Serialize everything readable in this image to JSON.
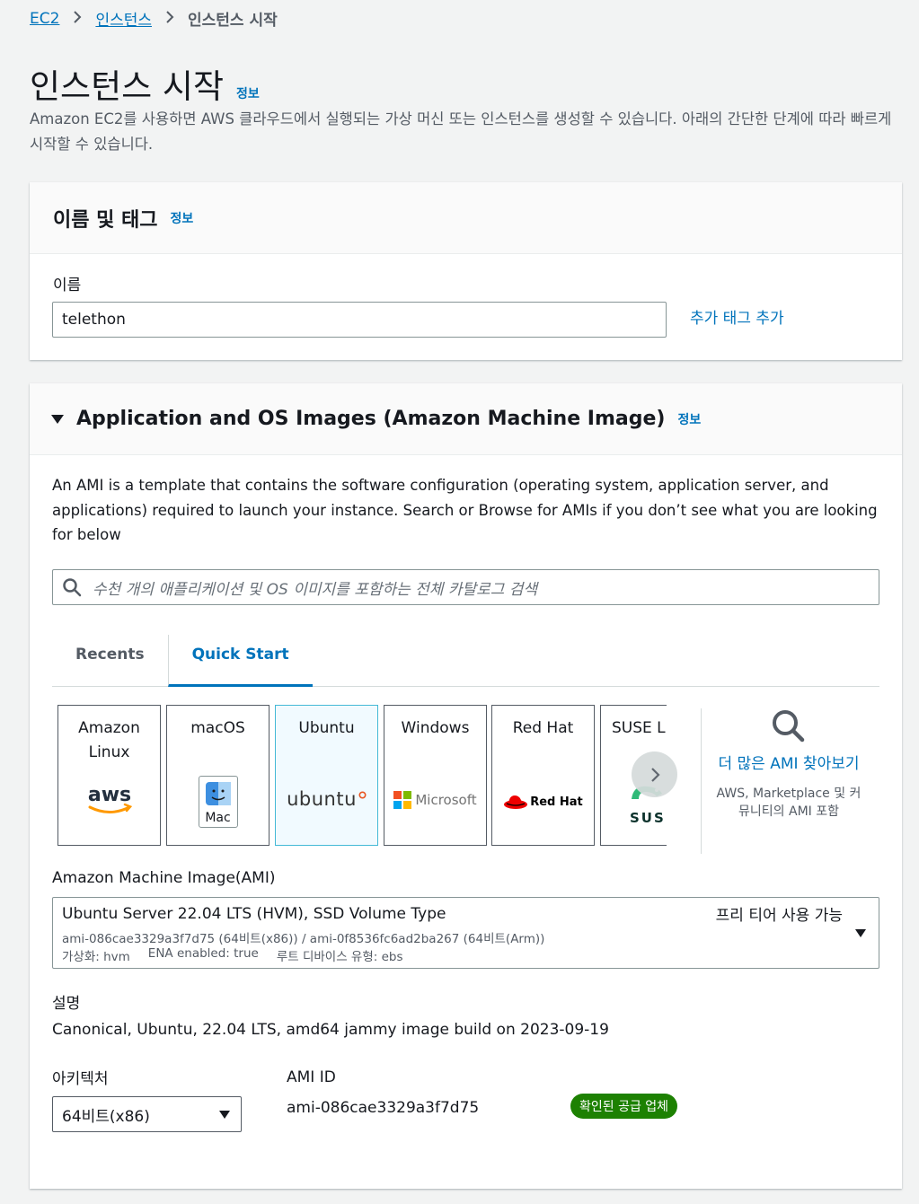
{
  "breadcrumb": {
    "items": [
      "EC2",
      "인스턴스"
    ],
    "current": "인스턴스 시작"
  },
  "page": {
    "title": "인스턴스 시작",
    "info": "정보",
    "description": "Amazon EC2를 사용하면 AWS 클라우드에서 실행되는 가상 머신 또는 인스턴스를 생성할 수 있습니다. 아래의 간단한 단계에 따라 빠르게 시작할 수 있습니다."
  },
  "name_tags": {
    "title": "이름 및 태그",
    "info": "정보",
    "name_label": "이름",
    "name_value": "telethon",
    "add_tags": "추가 태그 추가"
  },
  "ami": {
    "title": "Application and OS Images (Amazon Machine Image)",
    "info": "정보",
    "description": "An AMI is a template that contains the software configuration (operating system, application server, and applications) required to launch your instance. Search or Browse for AMIs if you don’t see what you are looking for below",
    "search_placeholder": "수천 개의 애플리케이션 및 OS 이미지를 포함하는 전체 카탈로그 검색",
    "tabs": [
      "Recents",
      "Quick Start"
    ],
    "active_tab": "Quick Start",
    "os_cards": [
      {
        "name": "Amazon Linux",
        "logo_text": "aws",
        "icon": "aws-logo-icon"
      },
      {
        "name": "macOS",
        "logo_text": "Mac",
        "icon": "mac-finder-icon"
      },
      {
        "name": "Ubuntu",
        "logo_text": "ubuntu",
        "icon": "ubuntu-logo-icon",
        "selected": true
      },
      {
        "name": "Windows",
        "logo_text": "Microsoft",
        "icon": "microsoft-logo-icon"
      },
      {
        "name": "Red Hat",
        "logo_text": "Red Hat",
        "icon": "redhat-logo-icon"
      },
      {
        "name": "SUSE Li",
        "logo_text": "SUSE",
        "icon": "suse-logo-icon"
      }
    ],
    "more_amis": {
      "link": "더 많은 AMI 찾아보기",
      "sub": "AWS, Marketplace 및 커뮤니티의 AMI 포함"
    },
    "ami_label": "Amazon Machine Image(AMI)",
    "selected_ami": {
      "name": "Ubuntu Server 22.04 LTS (HVM), SSD Volume Type",
      "free_tier": "프리 티어 사용 가능",
      "ids": "ami-086cae3329a3f7d75 (64비트(x86)) / ami-0f8536fc6ad2ba267 (64비트(Arm))",
      "virtualization": "가상화: hvm",
      "ena": "ENA enabled: true",
      "root_device": "루트 디바이스 유형: ebs"
    },
    "desc_label": "설명",
    "desc_value": "Canonical, Ubuntu, 22.04 LTS, amd64 jammy image build on 2023-09-19",
    "arch_label": "아키텍처",
    "arch_value": "64비트(x86)",
    "ami_id_label": "AMI ID",
    "ami_id_value": "ami-086cae3329a3f7d75",
    "verified_badge": "확인된 공급 업체"
  },
  "colors": {
    "link": "#0073bb",
    "badge": "#1d8102",
    "selected_card_bg": "#f1faff"
  }
}
